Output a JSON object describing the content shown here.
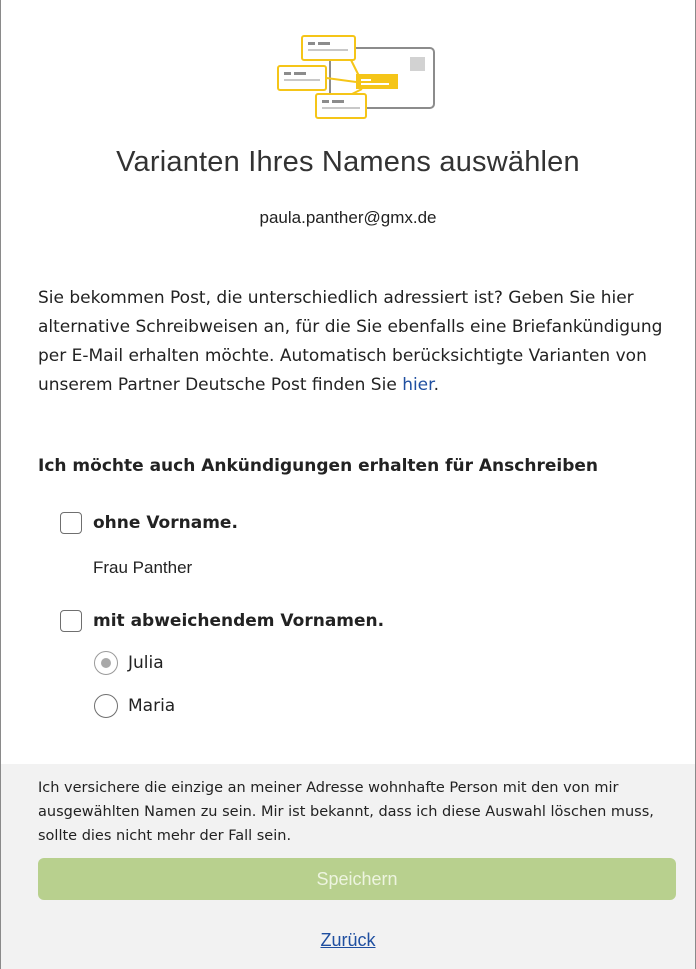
{
  "page": {
    "title": "Varianten Ihres Namens auswählen",
    "email": "paula.panther@gmx.de"
  },
  "intro": {
    "text": "Sie bekommen Post, die unterschiedlich adressiert ist? Geben Sie hier alternative Schreibweisen an, für die Sie ebenfalls eine Briefankündigung per E-Mail erhalten möchte. Automatisch berücksichtigte Varianten von unserem Partner Deutsche Post finden Sie ",
    "link_label": "hier",
    "suffix": "."
  },
  "section": {
    "heading": "Ich möchte auch Ankündigungen erhalten für Anschreiben"
  },
  "options": {
    "without_first_name": {
      "label": "ohne Vorname.",
      "checked": false,
      "example": "Frau Panther"
    },
    "different_first_name": {
      "label": "mit abweichendem Vornamen.",
      "checked": false,
      "choices": [
        {
          "label": "Julia",
          "selected": true
        },
        {
          "label": "Maria",
          "selected": false
        }
      ]
    }
  },
  "footer": {
    "disclaimer": "Ich versichere die einzige an meiner Adresse wohnhafte Person mit den von mir ausgewählten Namen zu sein. Mir ist bekannt, dass ich diese Auswahl löschen muss, sollte dies nicht mehr der Fall sein.",
    "save_label": "Speichern",
    "back_label": "Zurück"
  },
  "colors": {
    "accent_yellow": "#f5c518",
    "save_button": "#b8d08e",
    "link": "#1f4fa0",
    "footer_bg": "#f2f2f2"
  },
  "icons": {
    "illustration": "mail-variants-illustration"
  }
}
